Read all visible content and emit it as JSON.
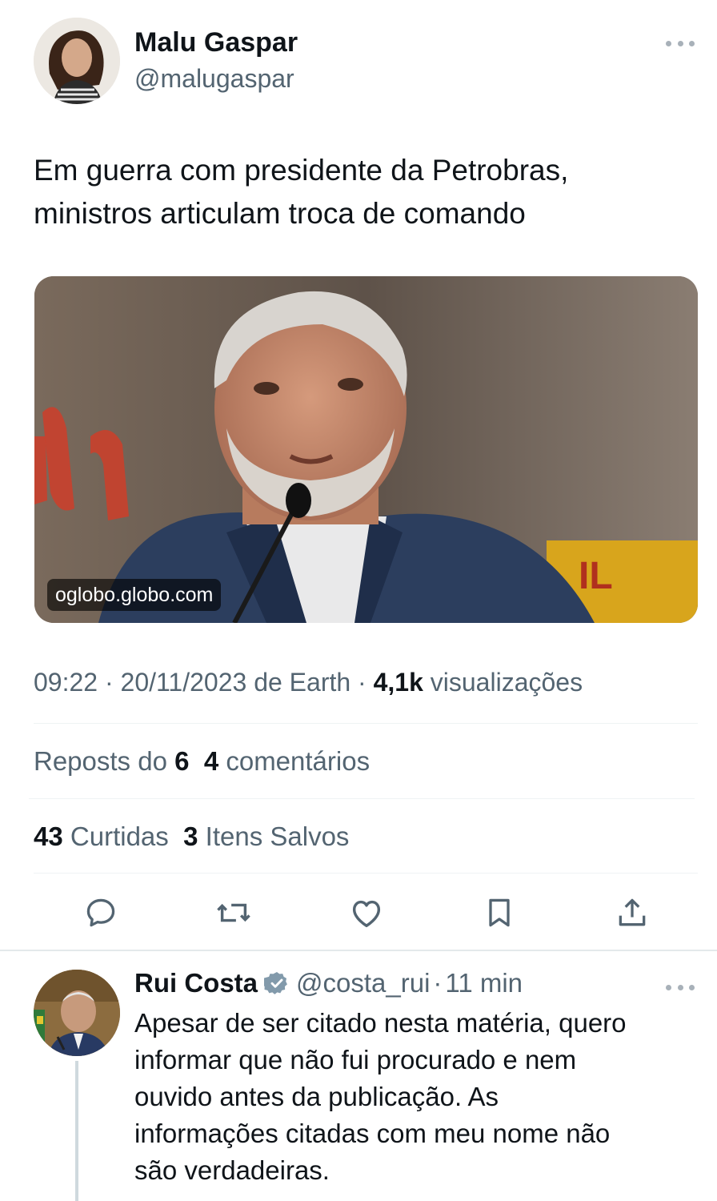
{
  "tweet": {
    "author_name": "Malu Gaspar",
    "author_handle": "@malugaspar",
    "text_lines": [
      "Em guerra com presidente da Petrobras,",
      "ministros articulam troca de comando"
    ],
    "media": {
      "domain": "oglobo.globo.com"
    },
    "time": "09:22",
    "date": "20/11/2023",
    "source": "de Earth",
    "views_count": "4,1k",
    "views_label": "visualizações",
    "separator": "·"
  },
  "stats": {
    "reposts_label": "Reposts do",
    "reposts_count": "6",
    "comments_count": "4",
    "comments_label": "comentários",
    "likes_count": "43",
    "likes_label": "Curtidas",
    "bookmarks_count": "3",
    "bookmarks_label": "Itens Salvos"
  },
  "actions": {
    "reply_icon": "reply-icon",
    "repost_icon": "repost-icon",
    "like_icon": "heart-icon",
    "bookmark_icon": "bookmark-icon",
    "share_icon": "share-icon"
  },
  "reply": {
    "author_name": "Rui Costa",
    "verified_icon": "verified-badge-icon",
    "author_handle": "@costa_rui",
    "separator": "·",
    "time": "11 min",
    "text_lines": [
      "Apesar de ser citado nesta matéria,  quero",
      "informar que não fui procurado  e nem",
      "ouvido antes da publicação. As",
      "informações citadas com meu nome não",
      "são verdadeiras."
    ]
  },
  "colors": {
    "text_primary": "#0f1419",
    "text_secondary": "#536471",
    "divider": "#eff3f4",
    "thread_line": "#cfd9de",
    "verified_badge": "#829aab"
  }
}
